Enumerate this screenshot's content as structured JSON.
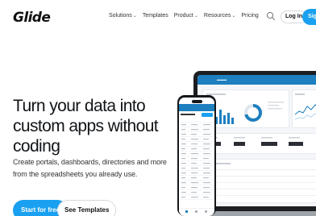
{
  "nav": {
    "logo": "Glide",
    "links": [
      {
        "label": "Solutions",
        "dropdown": true
      },
      {
        "label": "Templates",
        "dropdown": false
      },
      {
        "label": "Product",
        "dropdown": true
      },
      {
        "label": "Resources",
        "dropdown": true
      },
      {
        "label": "Pricing",
        "dropdown": false
      }
    ],
    "search_icon": "search-icon",
    "login_label": "Log In",
    "signup_label": "Sign"
  },
  "hero": {
    "headline": "Turn your data into custom apps without coding",
    "subtext": "Create portals, dashboards, directories and more from the spreadsheets you already use.",
    "primary_cta": "Start for free",
    "secondary_cta": "See Templates"
  },
  "colors": {
    "brand": "#1aa0f0",
    "app_header": "#1e7fbf"
  }
}
